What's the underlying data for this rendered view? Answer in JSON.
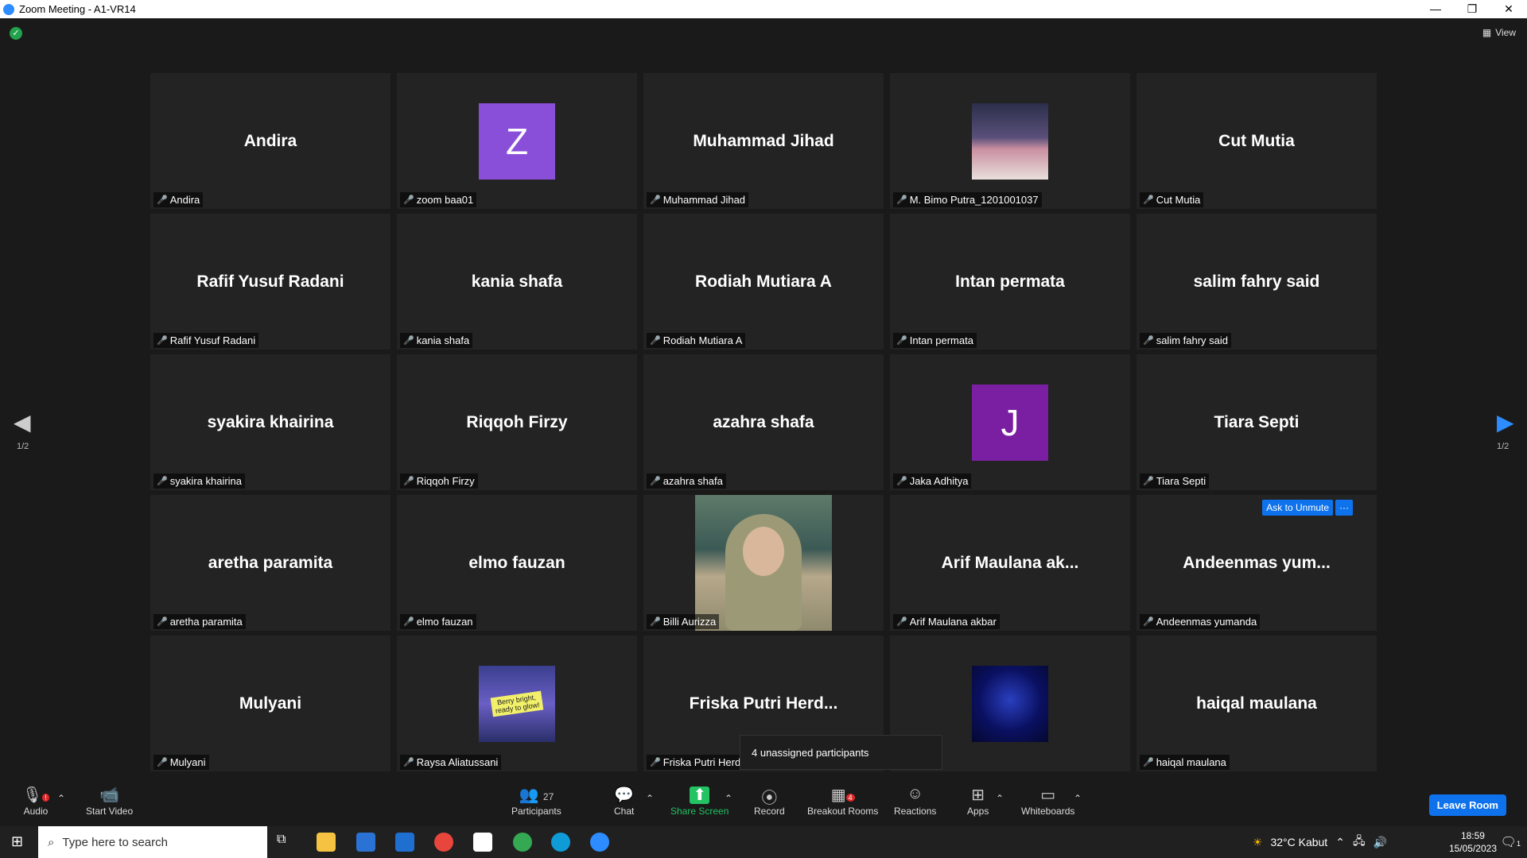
{
  "window": {
    "title": "Zoom Meeting - A1-VR14",
    "min": "—",
    "restore": "❐",
    "close": "✕"
  },
  "view_label": "View",
  "pages": {
    "left": "1/2",
    "right": "1/2"
  },
  "tiles": [
    {
      "big": "Andira",
      "label": "Andira"
    },
    {
      "avatar": "Z",
      "avatar_color": "#8a4fd8",
      "label": "zoom baa01"
    },
    {
      "big": "Muhammad Jihad",
      "label": "Muhammad Jihad"
    },
    {
      "photo": "photo-city",
      "label": "M. Bimo Putra_1201001037"
    },
    {
      "big": "Cut Mutia",
      "label": "Cut Mutia"
    },
    {
      "big": "Rafif Yusuf Radani",
      "label": "Rafif Yusuf Radani"
    },
    {
      "big": "kania shafa",
      "label": "kania shafa"
    },
    {
      "big": "Rodiah Mutiara A",
      "label": "Rodiah Mutiara A"
    },
    {
      "big": "Intan permata",
      "label": "Intan permata"
    },
    {
      "big": "salim fahry said",
      "label": "salim fahry said"
    },
    {
      "big": "syakira khairina",
      "label": "syakira khairina"
    },
    {
      "big": "Riqqoh Firzy",
      "label": "Riqqoh Firzy"
    },
    {
      "big": "azahra shafa",
      "label": "azahra shafa"
    },
    {
      "avatar": "J",
      "avatar_color": "#7b1fa2",
      "label": "Jaka Adhitya"
    },
    {
      "big": "Tiara Septi",
      "label": "Tiara Septi"
    },
    {
      "big": "aretha paramita",
      "label": "aretha paramita"
    },
    {
      "big": "elmo fauzan",
      "label": "elmo fauzan"
    },
    {
      "video": "person",
      "label": "Billi Aurizza"
    },
    {
      "big": "Arif Maulana ak...",
      "label": "Arif Maulana akbar"
    },
    {
      "big": "Andeenmas yum...",
      "label": "Andeenmas yumanda",
      "ask": "Ask to Unmute",
      "more": "···"
    },
    {
      "big": "Mulyani",
      "label": "Mulyani"
    },
    {
      "photo": "photo-glow",
      "photo_text": "Berry bright, ready to glow!",
      "label": "Raysa Aliatussani"
    },
    {
      "big": "Friska Putri Herd...",
      "label": "Friska Putri Herdi"
    },
    {
      "photo": "photo-dark",
      "label": ""
    },
    {
      "big": "haiqal maulana",
      "label": "haiqal maulana"
    }
  ],
  "tooltip": "4 unassigned participants",
  "toolbar": {
    "audio": "Audio",
    "audio_badge": "!",
    "start_video": "Start Video",
    "participants": "Participants",
    "participants_count": "27",
    "chat": "Chat",
    "share_screen": "Share Screen",
    "record": "Record",
    "breakout": "Breakout Rooms",
    "breakout_badge": "4",
    "reactions": "Reactions",
    "apps": "Apps",
    "whiteboards": "Whiteboards",
    "leave": "Leave Room",
    "accent": "#0e72ed"
  },
  "taskbar": {
    "search_placeholder": "Type here to search",
    "weather": "32°C  Kabut",
    "time": "18:59",
    "date": "15/05/2023",
    "notif_count": "1"
  }
}
